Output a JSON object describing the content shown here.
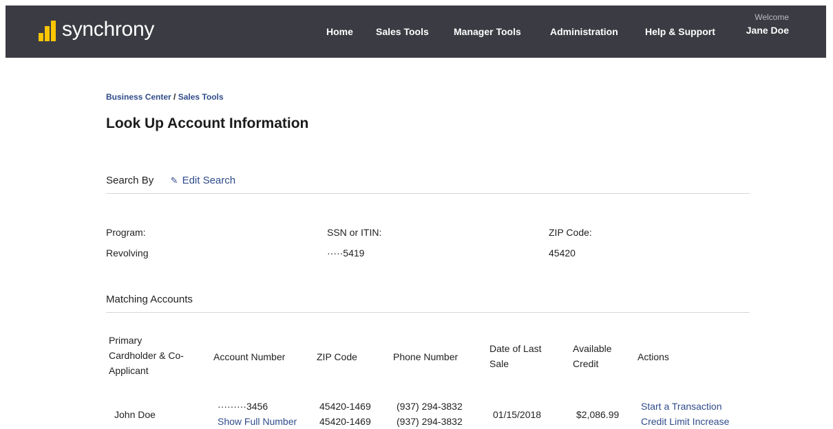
{
  "header": {
    "brand": "synchrony",
    "nav": [
      "Home",
      "Sales Tools",
      "Manager Tools",
      "Administration",
      "Help & Support"
    ],
    "welcome_label": "Welcome",
    "user_name": "Jane Doe",
    "colors": {
      "bar_bg": "#3b3c43",
      "logo_accent": "#fbc600"
    }
  },
  "breadcrumb": {
    "root": "Business Center",
    "separator": "/",
    "current": "Sales Tools"
  },
  "page_title": "Look Up Account Information",
  "search": {
    "heading": "Search By",
    "edit_label": "Edit Search",
    "fields": [
      {
        "label": "Program:",
        "value": "Revolving"
      },
      {
        "label": "SSN or ITIN:",
        "value": "·····5419"
      },
      {
        "label": "ZIP Code:",
        "value": "45420"
      }
    ]
  },
  "matching": {
    "heading": "Matching Accounts",
    "columns": {
      "holder": [
        "Primary",
        "Cardholder & Co-",
        "Applicant"
      ],
      "account": "Account Number",
      "zip": "ZIP Code",
      "phone": "Phone Number",
      "last_sale": [
        "Date of Last",
        "Sale"
      ],
      "credit": [
        "Available",
        "Credit"
      ],
      "actions": "Actions"
    },
    "rows": [
      {
        "holder": "John Doe",
        "account_masked": "·········3456",
        "show_full": "Show Full Number",
        "zip": [
          "45420-1469",
          "45420-1469"
        ],
        "phone": [
          "(937) 294-3832",
          "(937) 294-3832"
        ],
        "last_sale": "01/15/2018",
        "credit": "$2,086.99",
        "actions": [
          "Start a Transaction",
          "Credit Limit Increase"
        ]
      }
    ]
  },
  "theme": {
    "link_color": "#2f4b8a"
  }
}
